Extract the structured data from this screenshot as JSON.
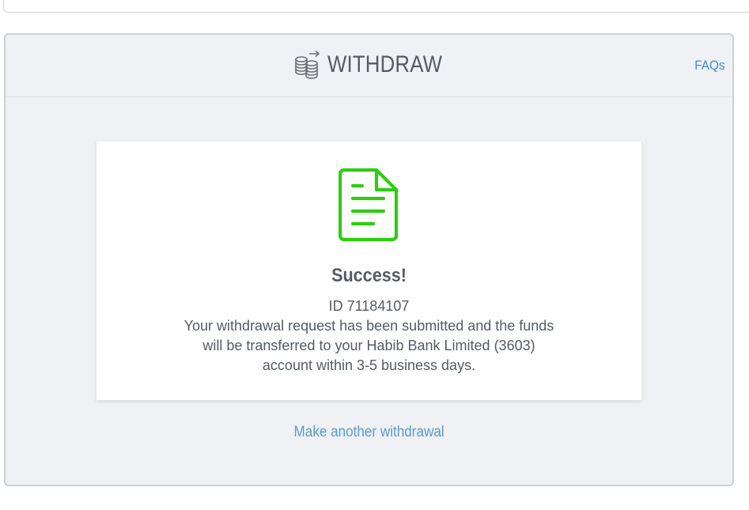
{
  "page": {
    "title": "WITHDRAW",
    "faqs_label": "FAQs"
  },
  "icons": {
    "header_icon": "coins-transfer-icon",
    "status_icon": "document-icon"
  },
  "colors": {
    "accent_link": "#3f8fcc",
    "success_green": "#2fcc0f",
    "text_primary": "#555b66"
  },
  "success": {
    "heading": "Success!",
    "id_line": "ID 71184107",
    "message": "Your withdrawal request has been submitted and the funds will be transferred to your Habib Bank Limited (3603) account within 3-5 business days."
  },
  "actions": {
    "make_another_label": "Make another withdrawal"
  }
}
